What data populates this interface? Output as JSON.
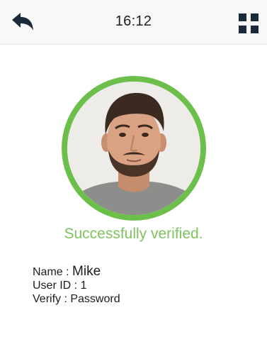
{
  "header": {
    "time": "16:12",
    "back_icon": "back-arrow-icon",
    "menu_icon": "grid-menu-icon"
  },
  "verification": {
    "status_text": "Successfully verified.",
    "status_color": "#80c35e",
    "ring_color": "#6cbf4a"
  },
  "user": {
    "name_label": "Name : ",
    "name_value": "Mike",
    "id_label": "User ID : ",
    "id_value": "1",
    "verify_label": "Verify : ",
    "verify_value": "Password"
  }
}
